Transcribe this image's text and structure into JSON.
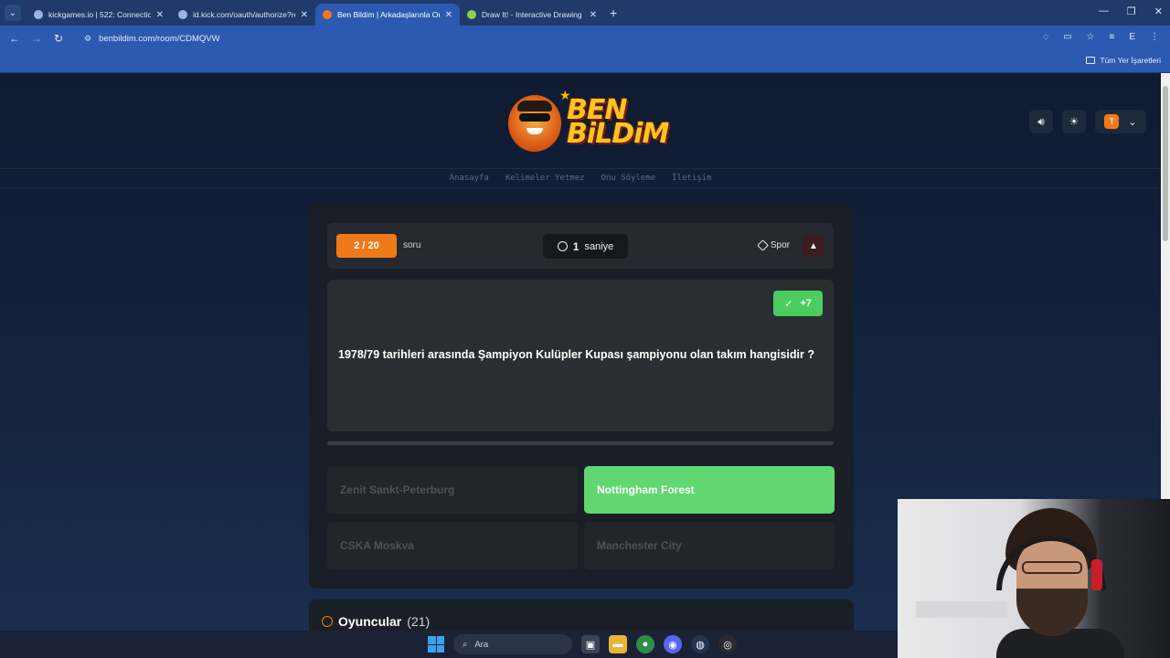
{
  "browser": {
    "tabs": [
      {
        "title": "kickgames.io | 522: Connection",
        "active": false
      },
      {
        "title": "id.kick.com/oauth/authorize?re",
        "active": false
      },
      {
        "title": "Ben Bildim | Arkadaşlarınla Onl",
        "active": true
      },
      {
        "title": "Draw It! - Interactive Drawing G",
        "active": false
      }
    ],
    "url": "benbildim.com/room/CDMQVW",
    "bookmarks_label": "Tüm Yer İşaretleri",
    "profile_initial": "E"
  },
  "site": {
    "logo_line1": "BEN",
    "logo_line2": "BiLDiM",
    "nav": [
      "Anasayfa",
      "Kelimeler Yetmez",
      "Onu Söyleme",
      "İletişim"
    ],
    "user_initial": "T"
  },
  "game": {
    "question_counter": "2 / 20",
    "question_suffix": "soru",
    "timer_value": "1",
    "timer_unit": "saniye",
    "category": "Spor",
    "points": "+7",
    "question": "1978/79 tarihleri arasında Şampiyon Kulüpler Kupası şampiyonu olan takım hangisidir ?",
    "answers": [
      {
        "label": "Zenit Sankt-Peterburg",
        "correct": false
      },
      {
        "label": "Nottingham Forest",
        "correct": true
      },
      {
        "label": "CSKA Moskva",
        "correct": false
      },
      {
        "label": "Manchester City",
        "correct": false
      }
    ],
    "colors": {
      "accent": "#f07a1a",
      "correct": "#60d770",
      "points": "#4ccc5e"
    }
  },
  "players": {
    "title": "Oyuncular",
    "count": "(21)"
  },
  "taskbar": {
    "search_placeholder": "Ara"
  }
}
